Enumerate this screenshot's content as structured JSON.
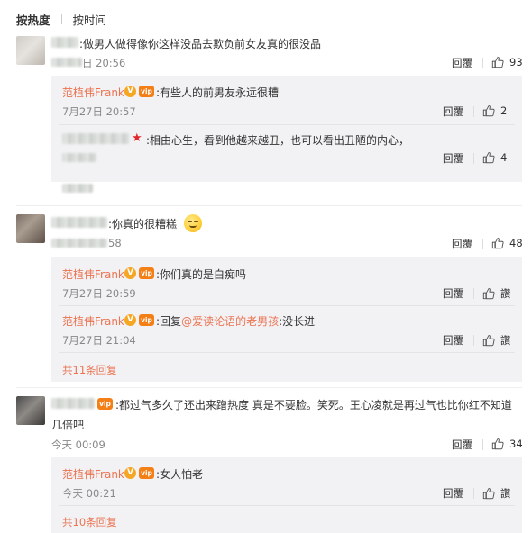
{
  "tabs": {
    "hot": "按热度",
    "time": "按时间"
  },
  "actions": {
    "reply": "回覆"
  },
  "comments": [
    {
      "text": "做男人做得像你这样没品去欺负前女友真的很没品",
      "time": "日 20:56",
      "likes": "93",
      "replies": [
        {
          "user": "范植伟Frank",
          "text": "有些人的前男友永远很糟",
          "time": "7月27日 20:57",
          "likes": "2"
        },
        {
          "text": "相由心生，看到他越来越丑，也可以看出丑陋的内心，",
          "likes": "4"
        }
      ]
    },
    {
      "text": "你真的很糟糕",
      "time": "58",
      "likes": "48",
      "replies": [
        {
          "user": "范植伟Frank",
          "text": "你们真的是白痴吗",
          "time": "7月27日 20:59",
          "likes": "讚"
        },
        {
          "user": "范植伟Frank",
          "prefix": "回复",
          "mention": "@爱读论语的老男孩",
          "text": ":没长进",
          "time": "7月27日 21:04",
          "likes": "讚"
        }
      ],
      "more": "共11条回复"
    },
    {
      "text_line1": "都过气多久了还出来蹭热度 真是不要脸。笑死。王心凌就是再过气也比你红不知道",
      "text_line2": "几倍吧",
      "time": "今天 00:09",
      "likes": "34",
      "replies": [
        {
          "user": "范植伟Frank",
          "text": "女人怕老",
          "time": "今天 00:21",
          "likes": "讚"
        }
      ],
      "more": "共10条回复"
    }
  ],
  "badges": {
    "verified": "V",
    "vip": "vip"
  }
}
